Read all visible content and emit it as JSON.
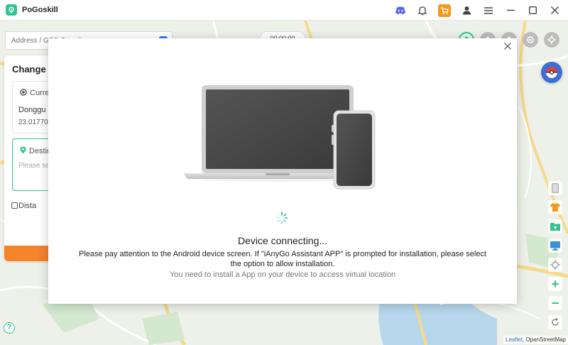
{
  "app": {
    "name": "PoGoskill"
  },
  "titlebar": {
    "icons": [
      "discord-icon",
      "bell-icon",
      "cart-icon",
      "user-icon",
      "menu-icon",
      "minimize-icon",
      "maximize-icon",
      "close-icon"
    ]
  },
  "search": {
    "placeholder": "Address / GPS Coordi..."
  },
  "time": "00:00:00",
  "left_panel": {
    "title": "Change L",
    "current_label": "Curre",
    "current_place": "Donggu",
    "current_coord": "23.01770",
    "destination_label": "Destin",
    "destination_placeholder": "Please se",
    "distance_label": "Dista"
  },
  "modal": {
    "status": "Device connecting...",
    "description": "Please pay attention to the Android device screen. If \"iAnyGo Assistant APP\" is prompted for installation, please select the option to allow installation.",
    "note": "You need to install a App on your device to access virtual location"
  },
  "map": {
    "attribution_leaflet": "Leaflet",
    "attribution_osm": ", OpenStreetMap",
    "zoom_in": "+",
    "zoom_out": "−",
    "help": "?"
  },
  "colors": {
    "brand": "#2dc48f",
    "accent": "#f6822a",
    "cart": "#f39a1e"
  }
}
